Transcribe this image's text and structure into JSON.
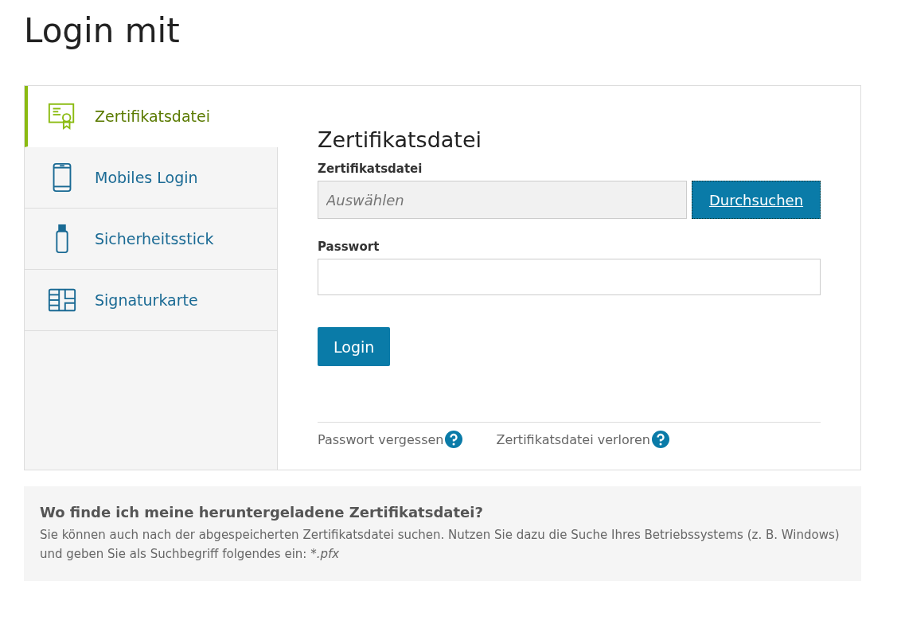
{
  "title": "Login mit",
  "tabs": [
    {
      "label": "Zertifikatsdatei",
      "kind": "certificate",
      "selected": true
    },
    {
      "label": "Mobiles Login",
      "kind": "phone",
      "selected": false
    },
    {
      "label": "Sicherheitsstick",
      "kind": "stick",
      "selected": false
    },
    {
      "label": "Signaturkarte",
      "kind": "card",
      "selected": false
    }
  ],
  "form": {
    "heading": "Zertifikatsdatei",
    "file_label": "Zertifikatsdatei",
    "file_placeholder": "Auswählen",
    "browse_button": "Durchsuchen",
    "password_label": "Passwort",
    "login_button": "Login",
    "links": [
      "Passwort vergessen",
      "Zertifikatsdatei verloren"
    ]
  },
  "help": {
    "heading": "Wo finde ich meine heruntergeladene Zertifikatsdatei?",
    "text": "Sie können auch nach der abgespeicherten Zertifikatsdatei suchen. Nutzen Sie dazu die Suche Ihres Betriebssystems (z. B. Windows) und geben Sie als Suchbegriff folgendes ein: ",
    "search_term": "*.pfx"
  }
}
